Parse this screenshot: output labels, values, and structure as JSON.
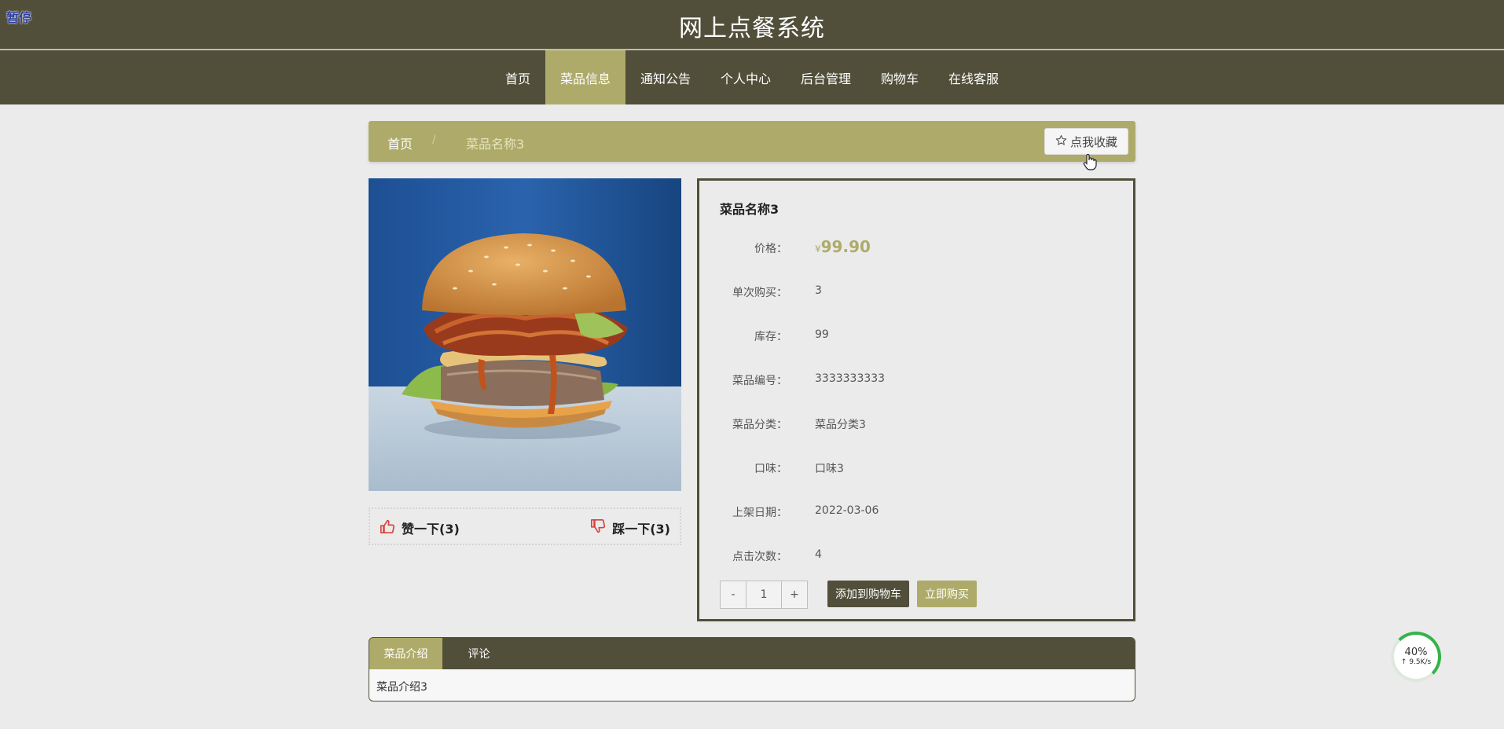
{
  "overlay": {
    "pause_label": "暂停"
  },
  "header": {
    "site_title": "网上点餐系统"
  },
  "nav": {
    "items": [
      "首页",
      "菜品信息",
      "通知公告",
      "个人中心",
      "后台管理",
      "购物车",
      "在线客服"
    ],
    "active": "菜品信息"
  },
  "breadcrumb": {
    "home": "首页",
    "separator": "/",
    "current": "菜品名称3"
  },
  "favorite": {
    "icon": "star-outline-icon",
    "label": "点我收藏"
  },
  "votes": {
    "like_label": "赞一下(3)",
    "dislike_label": "踩一下(3)"
  },
  "detail": {
    "name": "菜品名称3",
    "price_label": "价格：",
    "currency": "¥",
    "price": "99.90",
    "fields": [
      {
        "label": "单次购买：",
        "value": "3"
      },
      {
        "label": "库存：",
        "value": "99"
      },
      {
        "label": "菜品编号：",
        "value": "3333333333"
      },
      {
        "label": "菜品分类：",
        "value": "菜品分类3"
      },
      {
        "label": "口味：",
        "value": "口味3"
      },
      {
        "label": "上架日期：",
        "value": "2022-03-06"
      },
      {
        "label": "点击次数：",
        "value": "4"
      }
    ],
    "stepper": {
      "minus": "-",
      "qty": "1",
      "plus": "+"
    },
    "add_cart_label": "添加到购物车",
    "buy_now_label": "立即购买"
  },
  "tabs": {
    "items": [
      "菜品介绍",
      "评论"
    ],
    "active": "菜品介绍",
    "content": "菜品介绍3"
  },
  "speed_widget": {
    "percent": "40%",
    "rate": "↑ 9.5K/s"
  },
  "colors": {
    "brand_dark": "#514f3a",
    "accent": "#aeab6a",
    "vote_red": "#d9403a"
  }
}
